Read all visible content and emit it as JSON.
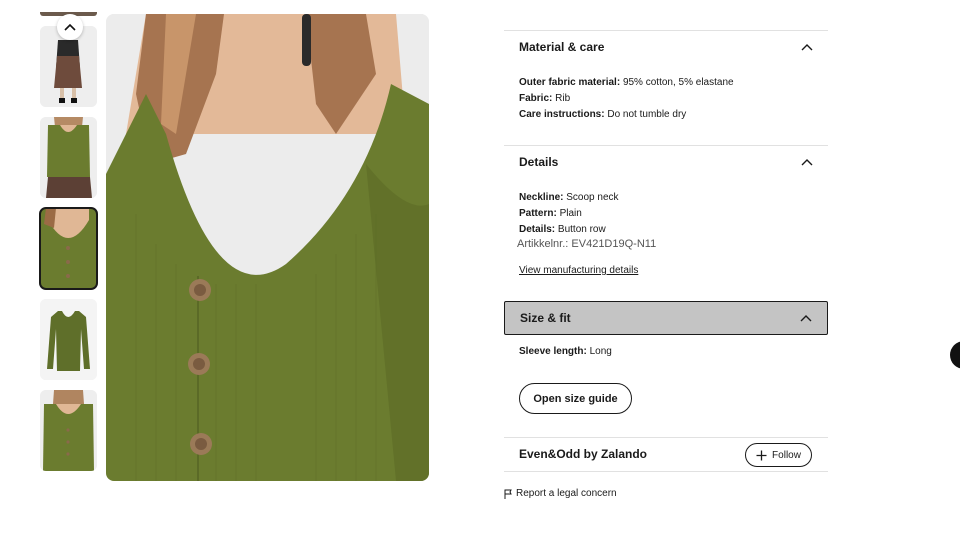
{
  "gallery": {
    "scroll_up_icon": "chevron-up-icon",
    "selected_index": 2,
    "thumbnails": [
      {
        "name": "thumbnail-full-outfit-front"
      },
      {
        "name": "thumbnail-top-with-skirt"
      },
      {
        "name": "thumbnail-neckline-closeup"
      },
      {
        "name": "thumbnail-product-flat"
      },
      {
        "name": "thumbnail-model-front"
      }
    ]
  },
  "material_care": {
    "title": "Material & care",
    "icon": "chevron-up-icon",
    "attributes": [
      {
        "label": "Outer fabric material:",
        "value": "95% cotton, 5% elastane"
      },
      {
        "label": "Fabric:",
        "value": "Rib"
      },
      {
        "label": "Care instructions:",
        "value": "Do not tumble dry"
      }
    ]
  },
  "details": {
    "title": "Details",
    "icon": "chevron-up-icon",
    "attributes": [
      {
        "label": "Neckline:",
        "value": "Scoop neck"
      },
      {
        "label": "Pattern:",
        "value": "Plain"
      },
      {
        "label": "Details:",
        "value": "Button row"
      }
    ],
    "article_number": "Artikkelnr.: EV421D19Q-N11",
    "manufacturing_link": "View manufacturing details"
  },
  "size_fit": {
    "title": "Size & fit",
    "icon": "chevron-up-icon",
    "attributes": [
      {
        "label": "Sleeve length:",
        "value": "Long"
      }
    ],
    "size_guide_button": "Open size guide"
  },
  "brand": {
    "name": "Even&Odd by Zalando",
    "follow_label": "Follow",
    "follow_icon": "plus-icon"
  },
  "report": {
    "label": "Report a legal concern",
    "icon": "flag-icon"
  },
  "colors": {
    "top_green": "#6b7c2f",
    "active_header_bg": "#c4c4c4",
    "text": "#1a1a1a"
  }
}
